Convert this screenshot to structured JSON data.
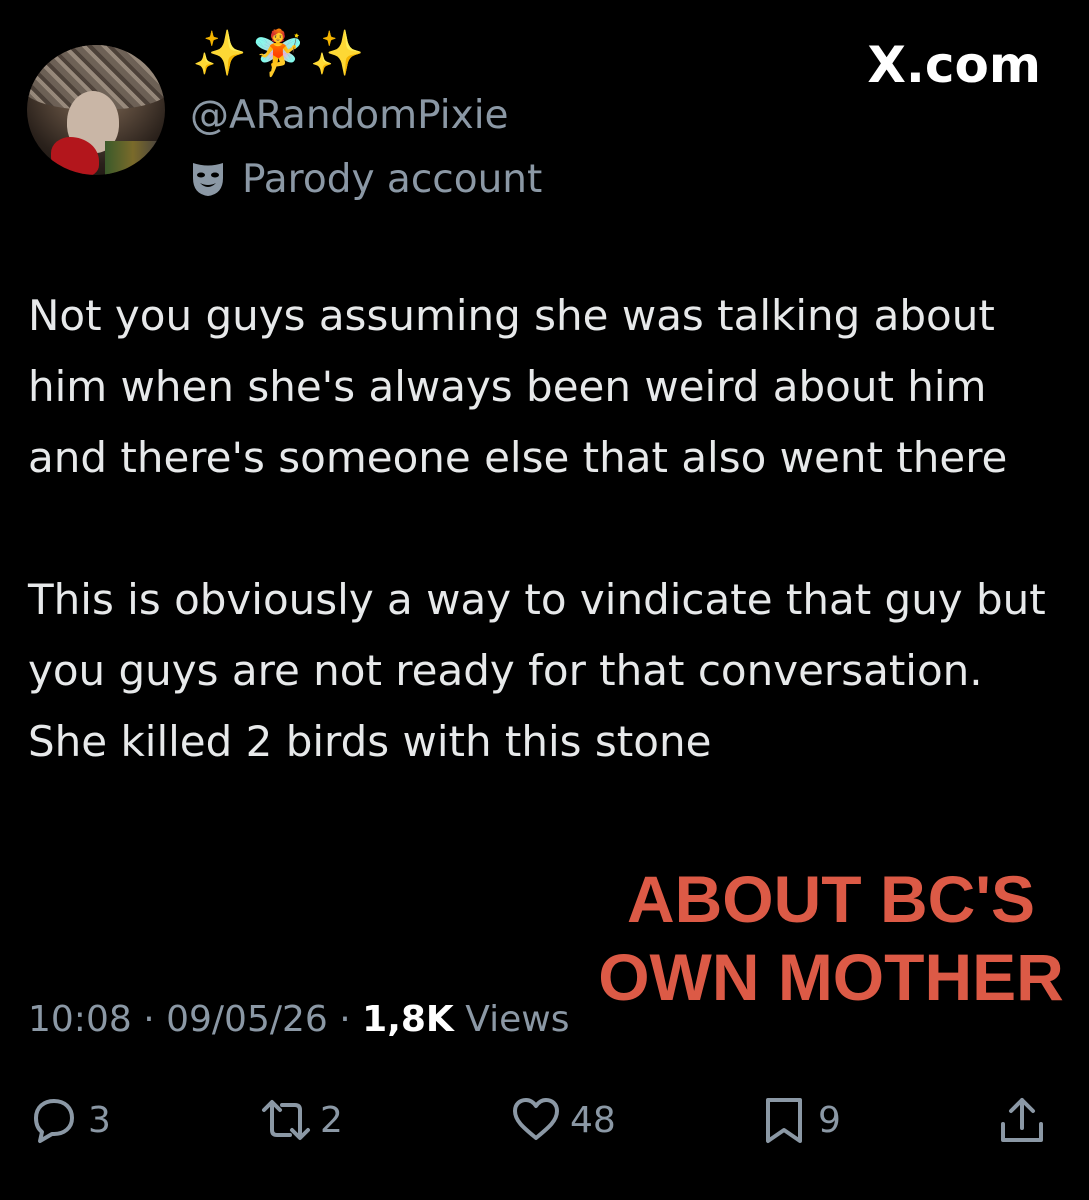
{
  "header": {
    "display_name_emoji": "✨🧚✨",
    "handle": "@ARandomPixie",
    "parody_label": "Parody account",
    "site_label": "X.com"
  },
  "post": {
    "paragraphs": [
      "Not you guys assuming she was talking about him when she's always been weird about him and there's someone else that also went there",
      "This is obviously a way to vindicate that guy but you guys are not ready for that conversation. She killed 2 birds with this stone"
    ],
    "time": "10:08",
    "date": "09/05/26",
    "separator": "·",
    "views_count": "1,8K",
    "views_label": "Views"
  },
  "overlay_caption": {
    "line1": "ABOUT BC'S",
    "line2": "OWN MOTHER",
    "color": "#dc5a46"
  },
  "actions": {
    "replies": {
      "icon": "reply-icon",
      "count": "3"
    },
    "reposts": {
      "icon": "repost-icon",
      "count": "2"
    },
    "likes": {
      "icon": "heart-icon",
      "count": "48"
    },
    "bookmarks": {
      "icon": "bookmark-icon",
      "count": "9"
    },
    "share": {
      "icon": "share-icon"
    }
  },
  "colors": {
    "background": "#000000",
    "text": "#e7e9ea",
    "secondary": "#8b98a5"
  }
}
